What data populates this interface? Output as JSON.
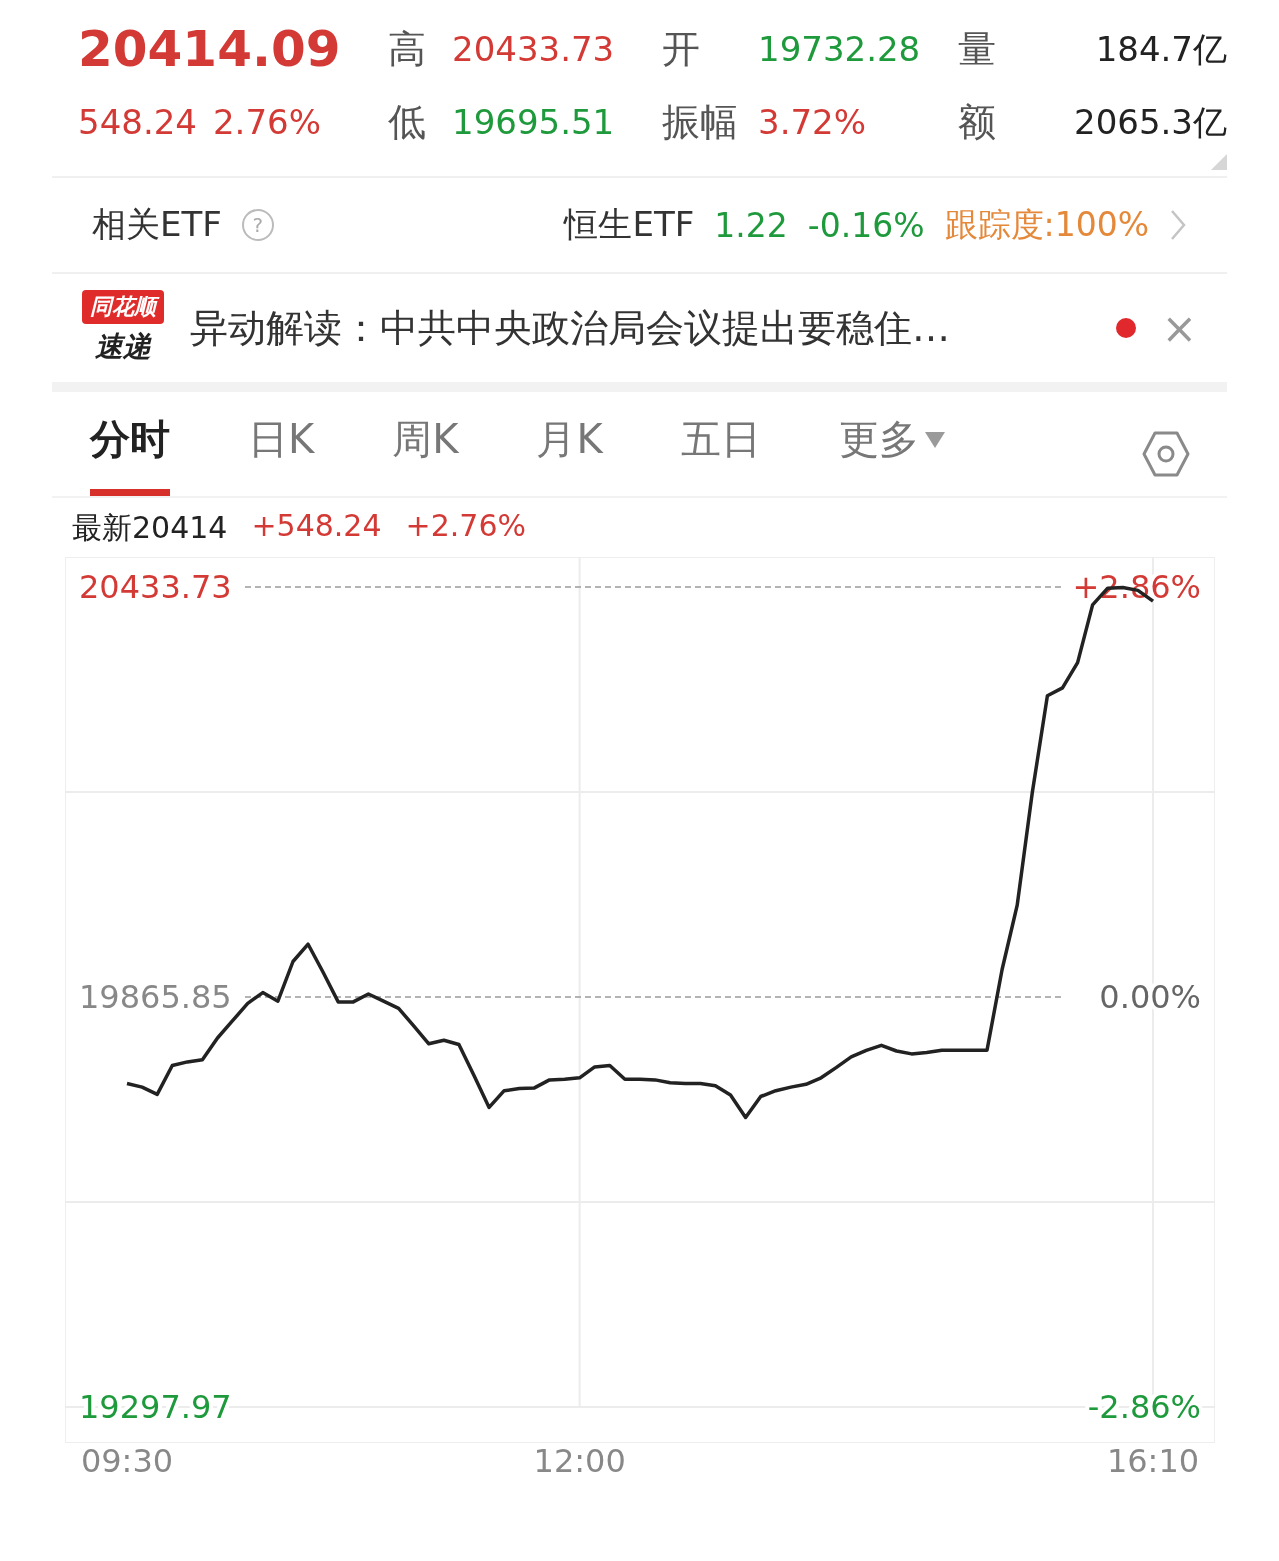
{
  "quote": {
    "price": "20414.09",
    "change": "548.24",
    "change_pct": "2.76%",
    "stats": [
      {
        "label": "高",
        "value": "20433.73",
        "color": "#d33a35"
      },
      {
        "label": "开",
        "value": "19732.28",
        "color": "#1e9a3c"
      },
      {
        "label": "量",
        "value": "184.7亿",
        "color": "#222222"
      },
      {
        "label": "低",
        "value": "19695.51",
        "color": "#1e9a3c"
      },
      {
        "label": "振幅",
        "value": "3.72%",
        "color": "#d33a35"
      },
      {
        "label": "额",
        "value": "2065.3亿",
        "color": "#222222"
      }
    ]
  },
  "etf": {
    "label": "相关ETF",
    "help": "?",
    "name": "恒生ETF",
    "price": "1.22",
    "change": "-0.16%",
    "color": "#1e9a3c",
    "tracking": "跟踪度:100%"
  },
  "news": {
    "logo_top": "同花顺",
    "logo_bottom": "速递",
    "text": "异动解读：中共中央政治局会议提出要稳住…",
    "unread": true,
    "close": "×"
  },
  "tabs": [
    {
      "label": "分时",
      "selected": true,
      "dropdown": false
    },
    {
      "label": "日K",
      "selected": false,
      "dropdown": false
    },
    {
      "label": "周K",
      "selected": false,
      "dropdown": false
    },
    {
      "label": "月K",
      "selected": false,
      "dropdown": false
    },
    {
      "label": "五日",
      "selected": false,
      "dropdown": false
    },
    {
      "label": "更多",
      "selected": false,
      "dropdown": true
    }
  ],
  "latest": {
    "label": "最新20414",
    "change": "+548.24",
    "change_pct": "+2.76%"
  },
  "chart": {
    "right_labels": [
      {
        "label": "+2.86%",
        "color": "#d33a35"
      },
      {
        "label": "0.00%",
        "color": "#666666"
      },
      {
        "label": "-2.86%",
        "color": "#1e9a3c"
      }
    ],
    "chart_data": {
      "type": "line",
      "ylim": [
        19297.97,
        20433.73
      ],
      "categories": [
        "09:30",
        null,
        null,
        null,
        null,
        null,
        null,
        null,
        null,
        null,
        null,
        null,
        null,
        null,
        null,
        null,
        null,
        null,
        null,
        null,
        null,
        null,
        null,
        null,
        null,
        null,
        null,
        null,
        null,
        null,
        "12:00",
        null,
        null,
        null,
        null,
        null,
        null,
        null,
        null,
        null,
        null,
        null,
        null,
        null,
        null,
        null,
        null,
        null,
        null,
        null,
        null,
        null,
        null,
        null,
        null,
        null,
        null,
        null,
        null,
        null,
        null,
        null,
        null,
        null,
        null,
        null,
        null,
        null,
        "16:10"
      ],
      "yticks": [
        {
          "value": 20433.73,
          "label": "20433.73"
        },
        {
          "value": 19865.85,
          "label": "19865.85"
        },
        {
          "value": 19297.97,
          "label": "19297.97"
        }
      ],
      "series": [
        {
          "color": "#222222",
          "values": [
            19746,
            19741,
            19731,
            19771,
            19776,
            19779,
            19809,
            19833,
            19857,
            19872,
            19860,
            19915,
            19939,
            19900,
            19859,
            19859,
            19870,
            19860,
            19850,
            19826,
            19801,
            19806,
            19800,
            19757,
            19713,
            19736,
            19739,
            19740,
            19751,
            19752,
            19754,
            19769,
            19771,
            19752,
            19752,
            19751,
            19747,
            19746,
            19746,
            19743,
            19730,
            19699,
            19728,
            19736,
            19741,
            19745,
            19754,
            19768,
            19783,
            19792,
            19799,
            19791,
            19787,
            19789,
            19792,
            19792,
            19792,
            19792,
            19904,
            19993,
            20149,
            20283,
            20294,
            20329,
            20409,
            20432,
            20433,
            20429,
            20414
          ]
        }
      ]
    }
  }
}
